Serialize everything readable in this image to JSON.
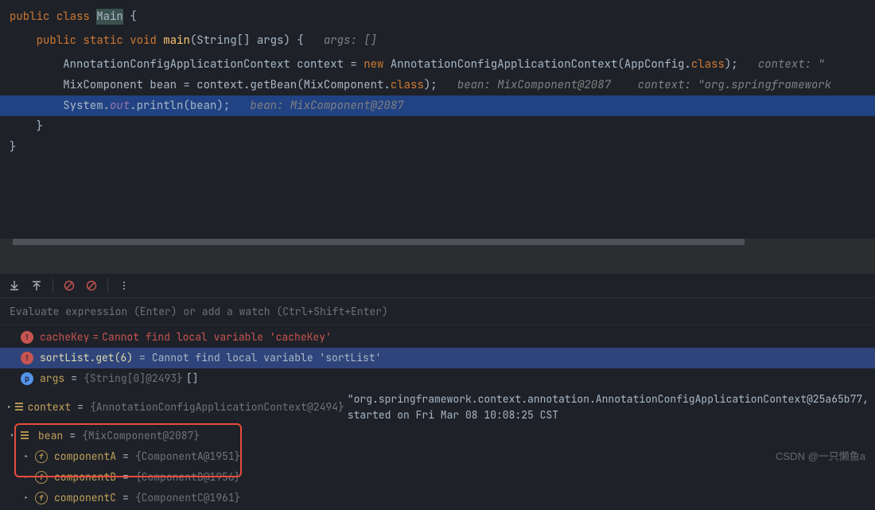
{
  "code": {
    "l1_kw1": "public",
    "l1_kw2": "class",
    "l1_name": "Main",
    "l1_brace": " {",
    "l2": "",
    "l3_indent": "    ",
    "l3_kw1": "public",
    "l3_kw2": "static",
    "l3_kw3": "void",
    "l3_fn": "main",
    "l3_sig": "(String[] args) {   ",
    "l3_hint": "args: []",
    "l4": "",
    "l5_indent": "        ",
    "l5_type": "AnnotationConfigApplicationContext context = ",
    "l5_new": "new",
    "l5_ctor": " AnnotationConfigApplicationContext(AppConfig.",
    "l5_class": "class",
    "l5_end": ");   ",
    "l5_hint": "context: \"",
    "l6_indent": "        ",
    "l6_a": "MixComponent bean = context.getBean(MixComponent.",
    "l6_class": "class",
    "l6_end": ");   ",
    "l6_hint1": "bean: MixComponent@2087    context: \"org.springframework",
    "l7_indent": "        ",
    "l7_sys": "System.",
    "l7_out": "out",
    "l7_call": ".println(bean);   ",
    "l7_hint": "bean: MixComponent@2087",
    "l8": "    }",
    "l9": "}"
  },
  "watchInput": "Evaluate expression (Enter) or add a watch (Ctrl+Shift+Enter)",
  "vars": {
    "cacheKey": {
      "name": "cacheKey",
      "eq": " = ",
      "val": "Cannot find local variable 'cacheKey'"
    },
    "sortList": {
      "name": "sortList.get(6)",
      "eq": " = ",
      "val": "Cannot find local variable 'sortList'"
    },
    "args": {
      "name": "args",
      "eq": " = ",
      "type": "{String[0]@2493}",
      "val": " []"
    },
    "context": {
      "name": "context",
      "eq": " = ",
      "type": "{AnnotationConfigApplicationContext@2494}",
      "val": " \"org.springframework.context.annotation.AnnotationConfigApplicationContext@25a65b77, started on Fri Mar 08 10:08:25 CST"
    },
    "bean": {
      "name": "bean",
      "eq": " = ",
      "type": "{MixComponent@2087}"
    },
    "compA": {
      "name": "componentA",
      "eq": " = ",
      "type": "{ComponentA@1951}"
    },
    "compB": {
      "name": "componentB",
      "eq": " = ",
      "type": "{ComponentB@1956}"
    },
    "compC": {
      "name": "componentC",
      "eq": " = ",
      "type": "{ComponentC@1961}"
    }
  },
  "watermark": "CSDN @一只懒鱼a"
}
